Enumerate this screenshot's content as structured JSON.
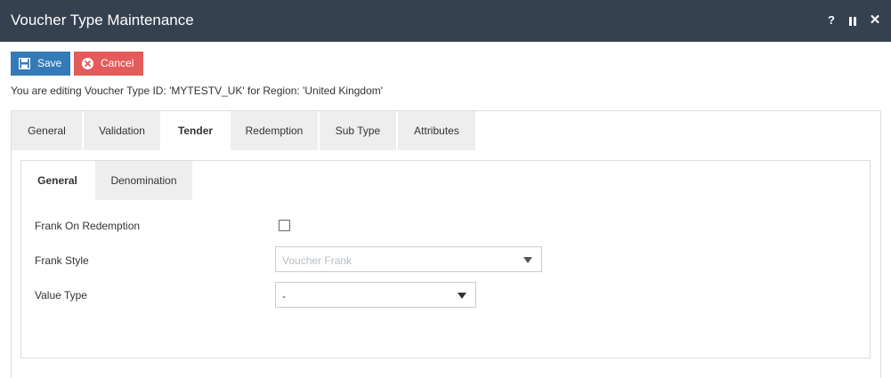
{
  "window": {
    "title": "Voucher Type Maintenance",
    "controls": {
      "help": "?",
      "close": "✕"
    }
  },
  "toolbar": {
    "save_label": "Save",
    "cancel_label": "Cancel"
  },
  "edit_message": "You are editing Voucher Type ID: 'MYTESTV_UK' for Region: 'United Kingdom'",
  "tabs": [
    {
      "label": "General",
      "active": false
    },
    {
      "label": "Validation",
      "active": false
    },
    {
      "label": "Tender",
      "active": true
    },
    {
      "label": "Redemption",
      "active": false
    },
    {
      "label": "Sub Type",
      "active": false
    },
    {
      "label": "Attributes",
      "active": false
    }
  ],
  "subtabs": [
    {
      "label": "General",
      "active": true
    },
    {
      "label": "Denomination",
      "active": false
    }
  ],
  "form": {
    "frank_on_redemption": {
      "label": "Frank On Redemption",
      "checked": false
    },
    "frank_style": {
      "label": "Frank Style",
      "value": "Voucher Frank",
      "disabled": true
    },
    "value_type": {
      "label": "Value Type",
      "value": "-",
      "disabled": false
    }
  },
  "colors": {
    "titlebar": "#364150",
    "save": "#337ab7",
    "cancel": "#e35b5a",
    "tab_inactive": "#eeeeee"
  }
}
